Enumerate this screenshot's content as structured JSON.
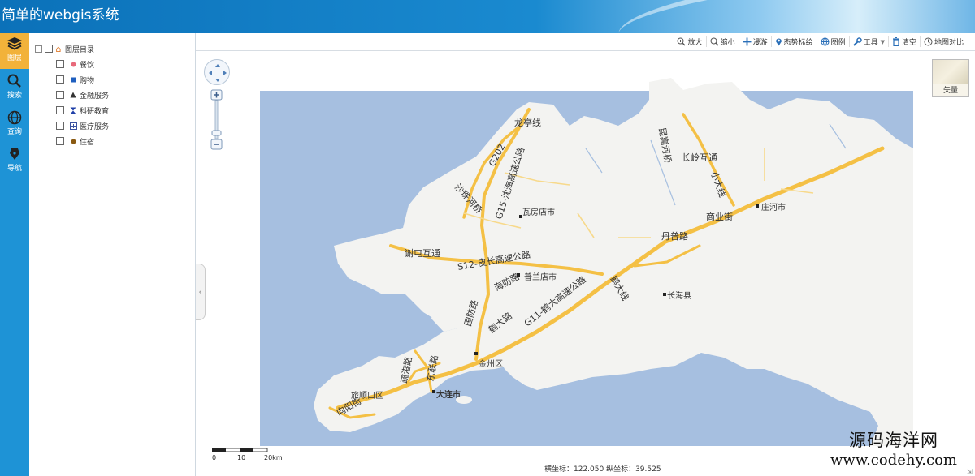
{
  "header": {
    "title": "简单的webgis系统"
  },
  "leftbar": {
    "items": [
      {
        "label": "图层",
        "icon": "layers-icon"
      },
      {
        "label": "搜索",
        "icon": "search-icon"
      },
      {
        "label": "查询",
        "icon": "globe-icon"
      },
      {
        "label": "导航",
        "icon": "pen-icon"
      }
    ]
  },
  "layer_tree": {
    "root": "图层目录",
    "items": [
      {
        "label": "餐饮",
        "icon": "restaurant-icon",
        "color": "#e8697a"
      },
      {
        "label": "购物",
        "icon": "shopping-icon",
        "color": "#1f5fbf"
      },
      {
        "label": "金融服务",
        "icon": "finance-icon",
        "color": "#333333"
      },
      {
        "label": "科研教育",
        "icon": "education-icon",
        "color": "#1f3fa8"
      },
      {
        "label": "医疗服务",
        "icon": "medical-icon",
        "color": "#3a52a0"
      },
      {
        "label": "住宿",
        "icon": "lodging-icon",
        "color": "#8a5a12"
      }
    ]
  },
  "toolbar": {
    "items": [
      {
        "label": "放大",
        "icon": "zoom-in-icon"
      },
      {
        "label": "缩小",
        "icon": "zoom-out-icon"
      },
      {
        "label": "漫游",
        "icon": "pan-icon"
      },
      {
        "label": "态势标绘",
        "icon": "marker-icon"
      },
      {
        "label": "图例",
        "icon": "legend-icon"
      },
      {
        "label": "工具",
        "icon": "tools-icon"
      },
      {
        "label": "清空",
        "icon": "trash-icon"
      },
      {
        "label": "地图对比",
        "icon": "compare-icon"
      }
    ]
  },
  "map": {
    "basemap_switch": "矢量",
    "scale": {
      "ticks": [
        "0",
        "10",
        "20km"
      ]
    },
    "coords_label": "横坐标：122.050 纵坐标：39.525",
    "road_labels": [
      "龙亭线",
      "G202",
      "G15-沈海高速公路",
      "沙珠河桥",
      "瓦房店市",
      "谢屯互通",
      "S12-皮长高速公路",
      "海防路",
      "普兰店市",
      "国防路",
      "鹤大路",
      "G11-鹤大高速公路",
      "鹤大线",
      "丹普路",
      "商业街",
      "庄河市",
      "长岭互通",
      "昆嵩河桥",
      "小大线",
      "长海县",
      "金州区",
      "疏港路",
      "东联路",
      "旅顺口区",
      "大连市",
      "向阳街"
    ]
  },
  "watermark": {
    "line1": "源码海洋网",
    "line2": "www.codehy.com"
  },
  "colors": {
    "header": "#0b71b9",
    "leftbar": "#1e93d6",
    "active": "#f2b23a",
    "sea": "#a6bfe0",
    "land": "#f3f3f1",
    "road": "#f4c045"
  }
}
